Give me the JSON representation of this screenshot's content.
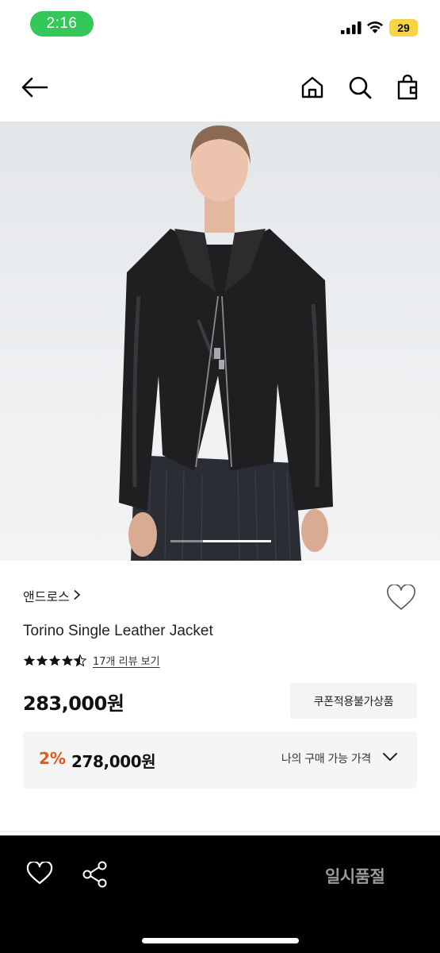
{
  "status_bar": {
    "time": "2:16",
    "battery": "29"
  },
  "header": {
    "back_icon": "arrow-left-icon",
    "home_icon": "home-icon",
    "search_icon": "search-icon",
    "bag_icon": "shopping-bag-icon"
  },
  "product": {
    "brand": "앤드로스",
    "brand_chevron": "›",
    "name": "Torino Single Leather Jacket",
    "rating": 4.5,
    "review_link": "17개 리뷰 보기",
    "price": "283,000원",
    "coupon_label": "쿠폰적용불가상품",
    "image_slide": {
      "current": 2,
      "total": 3
    }
  },
  "discount": {
    "percent": "2%",
    "price": "278,000원",
    "my_price_label": "나의 구매 가능 가격"
  },
  "bottom_bar": {
    "status_label": "일시품절"
  },
  "colors": {
    "discount": "#e8561b",
    "time_pill": "#34c759",
    "battery": "#f5d547",
    "bottom_bar": "#000000"
  }
}
